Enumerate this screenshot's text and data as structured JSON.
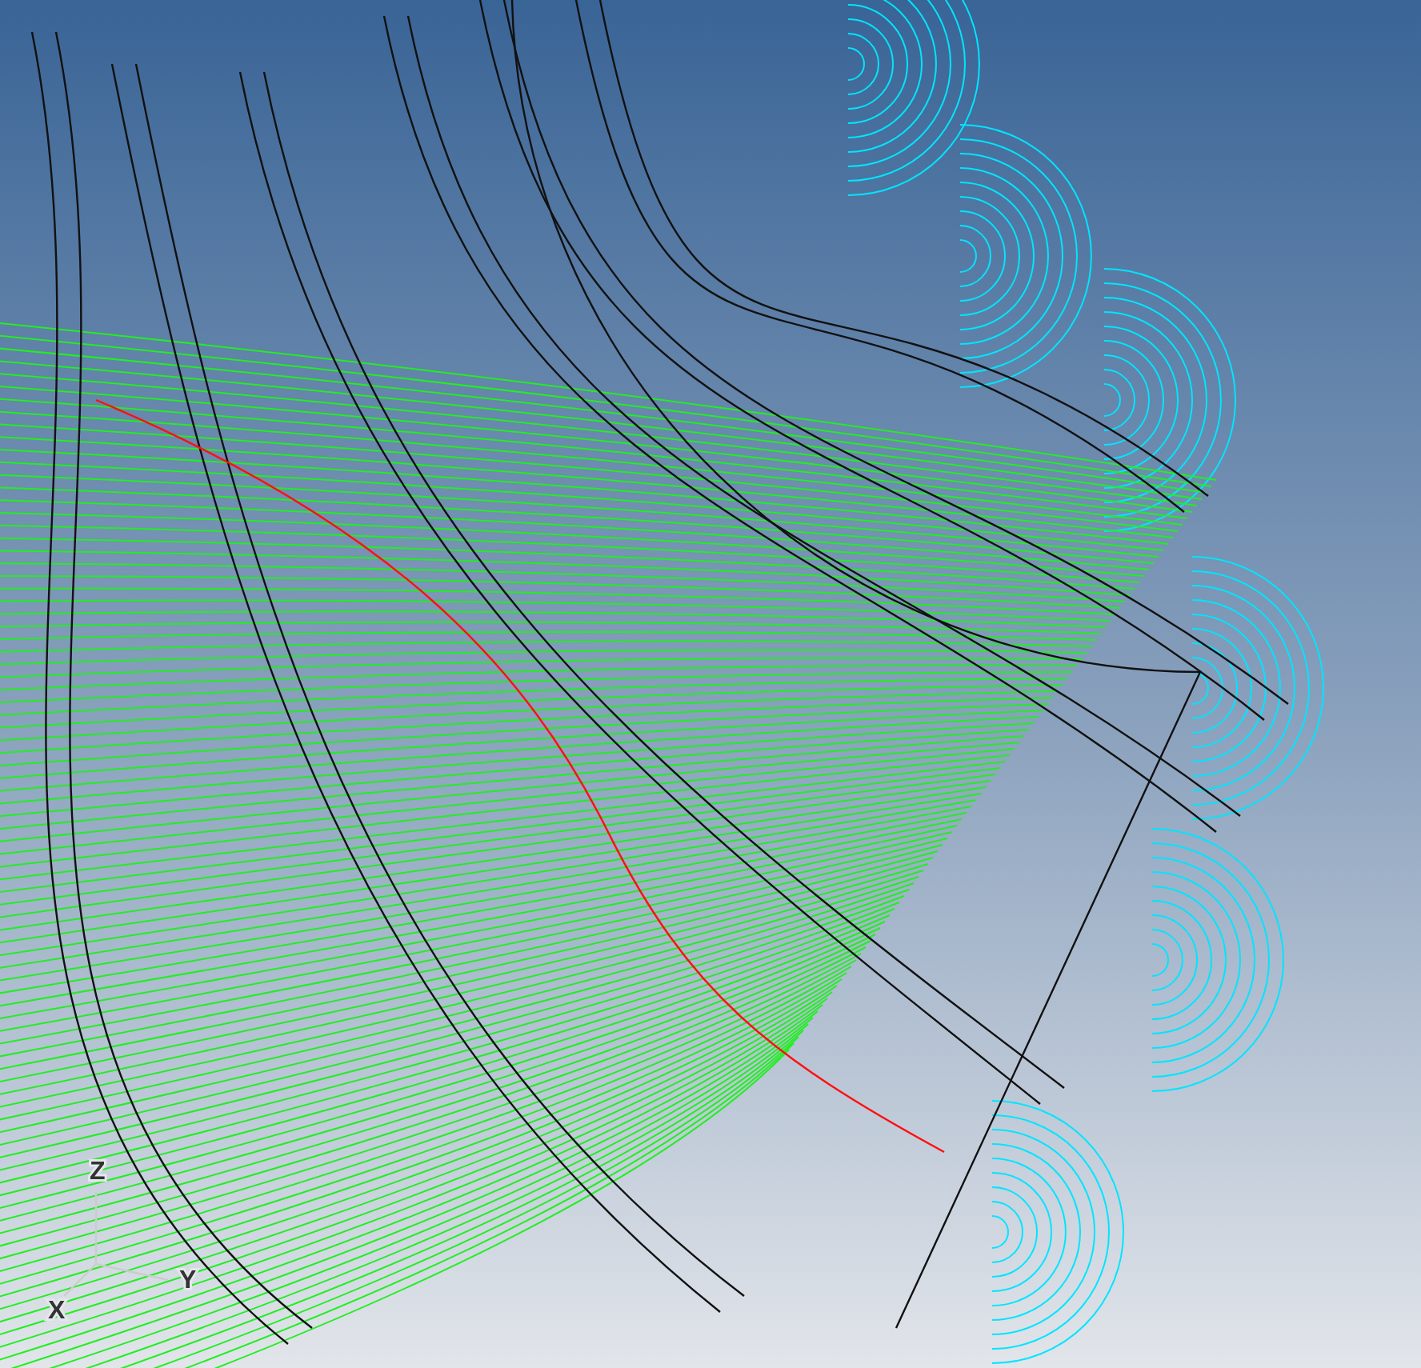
{
  "viewport": {
    "axis_labels": [
      {
        "kind": "z",
        "text": "Z"
      },
      {
        "kind": "y",
        "text": "Y"
      },
      {
        "kind": "x",
        "text": "X"
      }
    ]
  }
}
